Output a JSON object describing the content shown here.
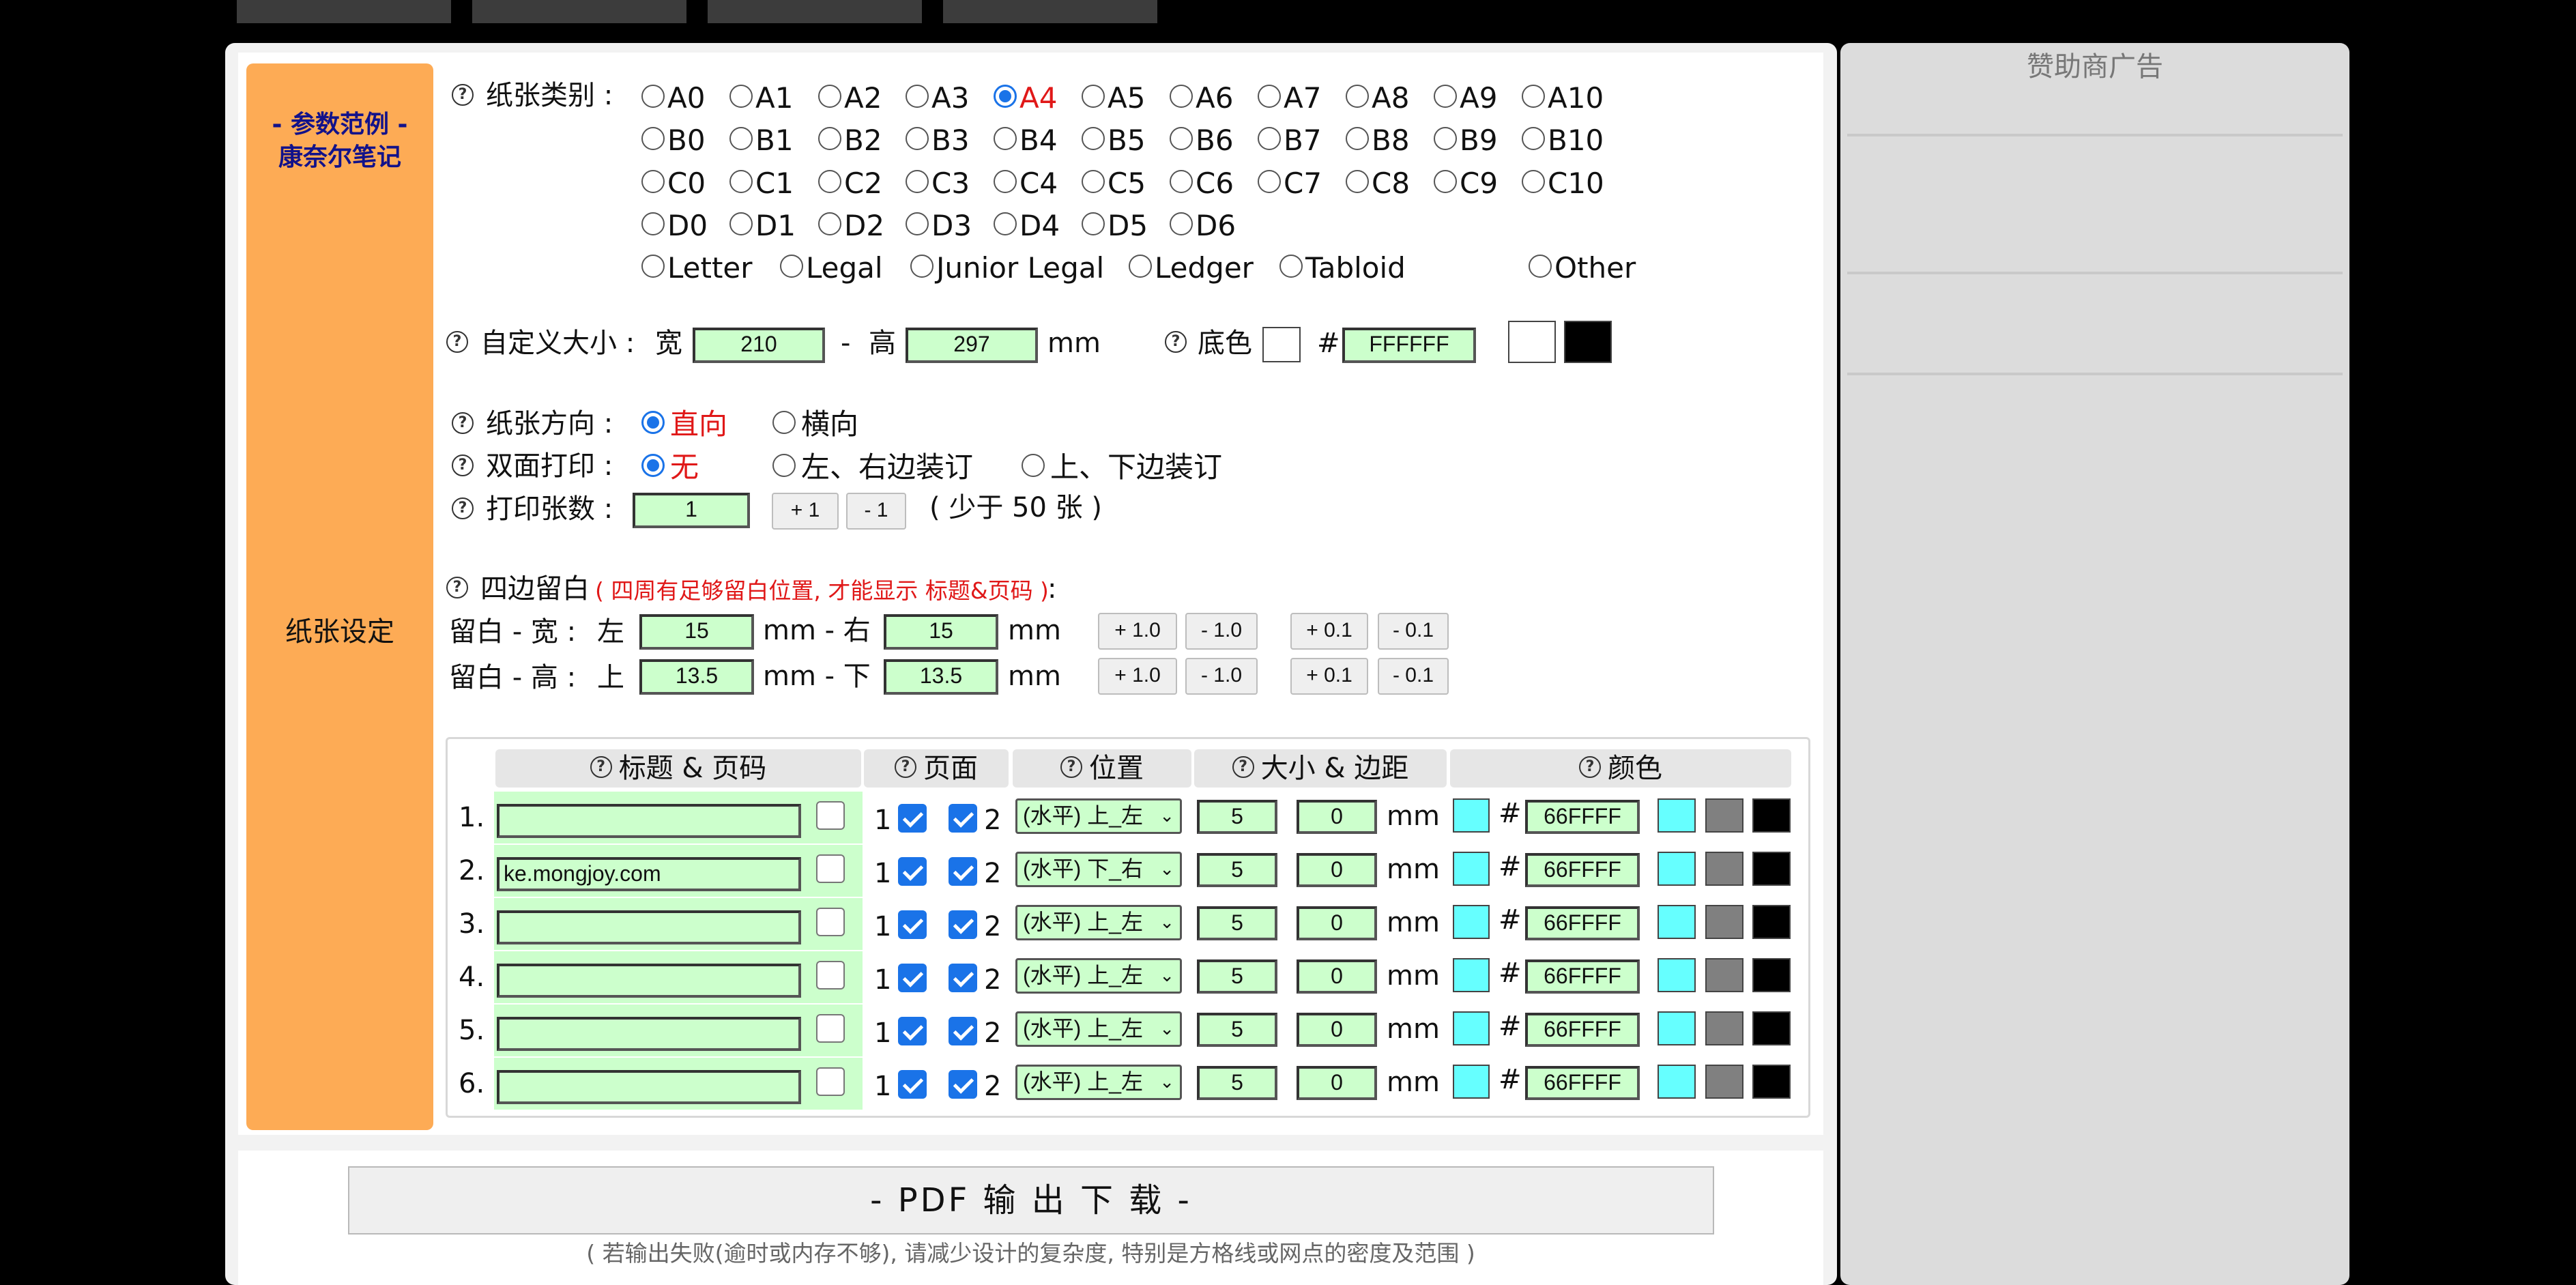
{
  "sidebar": {
    "example_line1": "- 参数范例 -",
    "example_line2": "康奈尔笔记",
    "section_label": "纸张设定"
  },
  "paper_type": {
    "label": "纸张类别 :",
    "rows": [
      [
        "A0",
        "A1",
        "A2",
        "A3",
        "A4",
        "A5",
        "A6",
        "A7",
        "A8",
        "A9",
        "A10"
      ],
      [
        "B0",
        "B1",
        "B2",
        "B3",
        "B4",
        "B5",
        "B6",
        "B7",
        "B8",
        "B9",
        "B10"
      ],
      [
        "C0",
        "C1",
        "C2",
        "C3",
        "C4",
        "C5",
        "C6",
        "C7",
        "C8",
        "C9",
        "C10"
      ],
      [
        "D0",
        "D1",
        "D2",
        "D3",
        "D4",
        "D5",
        "D6"
      ]
    ],
    "extra": [
      "Letter",
      "Legal",
      "Junior Legal",
      "Ledger",
      "Tabloid",
      "Other"
    ],
    "selected": "A4"
  },
  "custom_size": {
    "label": "自定义大小 :",
    "width_label": "宽",
    "width": "210",
    "sep": "-",
    "height_label": "高",
    "height": "297",
    "unit": "mm"
  },
  "bg_color": {
    "label": "底色",
    "hash": "#",
    "value": "FFFFFF"
  },
  "orientation": {
    "label": "纸张方向 :",
    "portrait": "直向",
    "landscape": "横向",
    "selected": "portrait"
  },
  "duplex": {
    "label": "双面打印 :",
    "none": "无",
    "lr": "左、右边装订",
    "tb": "上、下边装订",
    "selected": "none"
  },
  "copies": {
    "label": "打印张数 :",
    "value": "1",
    "plus": "+ 1",
    "minus": "- 1",
    "note": "( 少于 50 张 )"
  },
  "margins": {
    "title": "四边留白",
    "note": "( 四周有足够留白位置, 才能显示 标题&页码 )",
    "colon": ":",
    "width_row": {
      "label": "留白 - 宽 :",
      "first_label": "左",
      "first": "15",
      "mid": "mm - 右",
      "second": "15",
      "unit": "mm"
    },
    "height_row": {
      "label": "留白 - 高 :",
      "first_label": "上",
      "first": "13.5",
      "mid": "mm - 下",
      "second": "13.5",
      "unit": "mm"
    },
    "buttons": [
      "+ 1.0",
      "- 1.0",
      "+ 0.1",
      "- 0.1"
    ]
  },
  "header_table": {
    "columns": [
      "标题 & 页码",
      "页面",
      "位置",
      "大小 & 边距",
      "颜色"
    ],
    "page_labels": [
      "1",
      "2"
    ],
    "unit": "mm",
    "hash": "#",
    "rows": [
      {
        "num": "1.",
        "text": "",
        "position": "(水平) 上_左",
        "size": "5",
        "margin": "0",
        "color": "66FFFF"
      },
      {
        "num": "2.",
        "text": "ke.mongjoy.com",
        "position": "(水平) 下_右",
        "size": "5",
        "margin": "0",
        "color": "66FFFF"
      },
      {
        "num": "3.",
        "text": "",
        "position": "(水平) 上_左",
        "size": "5",
        "margin": "0",
        "color": "66FFFF"
      },
      {
        "num": "4.",
        "text": "",
        "position": "(水平) 上_左",
        "size": "5",
        "margin": "0",
        "color": "66FFFF"
      },
      {
        "num": "5.",
        "text": "",
        "position": "(水平) 上_左",
        "size": "5",
        "margin": "0",
        "color": "66FFFF"
      },
      {
        "num": "6.",
        "text": "",
        "position": "(水平) 上_左",
        "size": "5",
        "margin": "0",
        "color": "66FFFF"
      }
    ]
  },
  "pdf": {
    "button": "- PDF 输 出 下 载 -",
    "note": "( 若输出失败(逾时或内存不够), 请减少设计的复杂度, 特别是方格线或网点的密度及范围 )"
  },
  "sponsor": {
    "title": "赞助商广告"
  },
  "colors": {
    "accent_orange": "#fdab55",
    "input_green": "#ccffcc",
    "cyan": "#66ffff",
    "radio_blue": "#1a73e8",
    "selected_red": "#e01818"
  }
}
